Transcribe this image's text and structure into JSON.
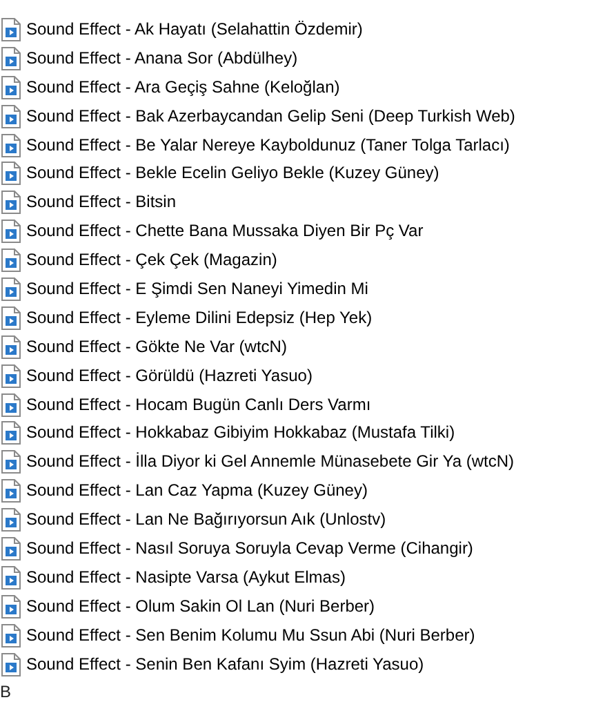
{
  "files": [
    {
      "name": "Sound Effect - Ak Hayatı (Selahattin Özdemir)"
    },
    {
      "name": "Sound Effect - Anana Sor (Abdülhey)"
    },
    {
      "name": "Sound Effect - Ara Geçiş Sahne (Keloğlan)"
    },
    {
      "name": "Sound Effect - Bak Azerbaycandan Gelip Seni (Deep Turkish Web)"
    },
    {
      "name": "Sound Effect - Be Yalar Nereye Kayboldunuz (Taner Tolga Tarlacı)"
    },
    {
      "name": "Sound Effect - Bekle Ecelin Geliyo Bekle (Kuzey Güney)"
    },
    {
      "name": "Sound Effect - Bitsin"
    },
    {
      "name": "Sound Effect - Chette Bana Mussaka Diyen Bir Pç Var"
    },
    {
      "name": "Sound Effect - Çek Çek (Magazin)"
    },
    {
      "name": "Sound Effect - E Şimdi Sen Naneyi Yimedin Mi"
    },
    {
      "name": "Sound Effect - Eyleme Dilini Edepsiz (Hep Yek)"
    },
    {
      "name": "Sound Effect - Gökte Ne Var (wtcN)"
    },
    {
      "name": "Sound Effect - Görüldü (Hazreti Yasuo)"
    },
    {
      "name": "Sound Effect - Hocam Bugün Canlı Ders Varmı"
    },
    {
      "name": "Sound Effect - Hokkabaz Gibiyim Hokkabaz (Mustafa Tilki)"
    },
    {
      "name": "Sound Effect - İlla Diyor ki Gel Annemle Münasebete Gir Ya (wtcN)"
    },
    {
      "name": "Sound Effect - Lan Caz Yapma (Kuzey Güney)"
    },
    {
      "name": "Sound Effect - Lan Ne Bağırıyorsun Aık (Unlostv)"
    },
    {
      "name": "Sound Effect - Nasıl Soruya Soruyla Cevap Verme (Cihangir)"
    },
    {
      "name": "Sound Effect - Nasipte Varsa (Aykut Elmas)"
    },
    {
      "name": "Sound Effect - Olum Sakin Ol Lan (Nuri Berber)"
    },
    {
      "name": "Sound Effect - Sen Benim Kolumu Mu Ssun Abi (Nuri Berber)"
    },
    {
      "name": "Sound Effect - Senin Ben Kafanı Syim (Hazreti Yasuo)"
    }
  ],
  "footer": "B"
}
